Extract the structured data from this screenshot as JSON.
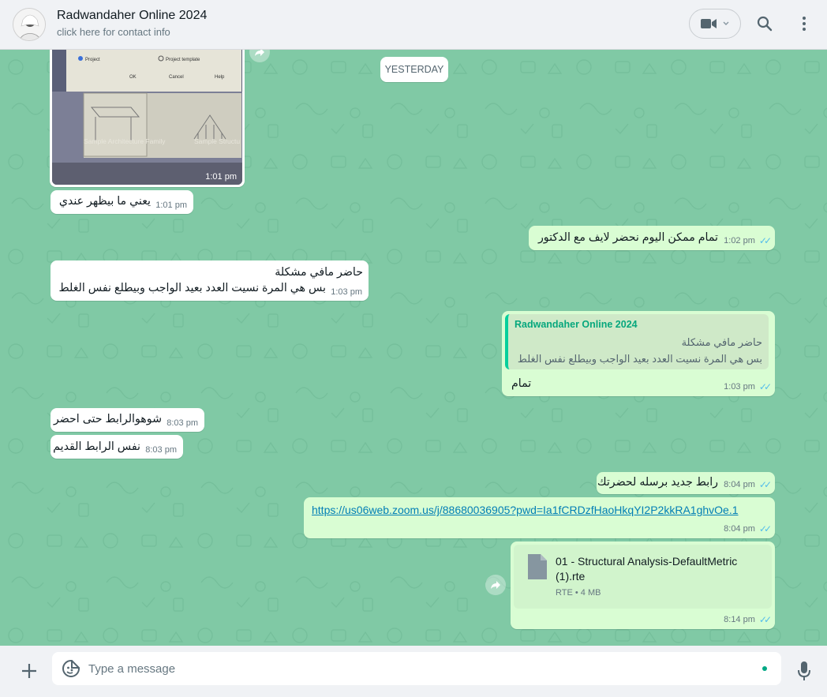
{
  "header": {
    "contact_name": "Radwandaher Online 2024",
    "subtitle": "click here for contact info"
  },
  "chat": {
    "day_divider": "YESTERDAY",
    "image_message": {
      "time": "1:01 pm",
      "image_labels": [
        "Project",
        "Project template",
        "OK",
        "Cancel",
        "Help",
        "Sample Architecture Family",
        "Sample Structu Family"
      ]
    },
    "messages": [
      {
        "dir": "in",
        "text": "يعني ما بيظهر عندي",
        "time": "1:01 pm"
      },
      {
        "dir": "out",
        "text": "تمام ممكن اليوم نحضر لايف  مع الدكتور",
        "time": "1:02 pm"
      },
      {
        "dir": "in",
        "line1": "حاضر مافي مشكلة",
        "line2": "بس هي المرة نسيت العدد بعيد الواجب وبيطلع نفس الغلط",
        "time": "1:03 pm"
      },
      {
        "dir": "out",
        "quote_author": "Radwandaher Online 2024",
        "quote_line1": "حاضر مافي مشكلة",
        "quote_line2": "بس هي المرة نسيت العدد بعيد الواجب وبيطلع نفس الغلط",
        "text": "تمام",
        "time": "1:03 pm"
      },
      {
        "dir": "in",
        "text": "شوهوالرابط حتى احضر",
        "time": "8:03 pm"
      },
      {
        "dir": "in",
        "text": "نفس الرابط القديم",
        "time": "8:03 pm"
      },
      {
        "dir": "out",
        "text": "رابط جديد برسله لحضرتك",
        "time": "8:04 pm"
      },
      {
        "dir": "out",
        "link": "https://us06web.zoom.us/j/88680036905?pwd=Ia1fCRDzfHaoHkqYI2P2kkRA1ghvOe.1",
        "time": "8:04 pm"
      },
      {
        "dir": "out",
        "file_name_line1": "01 - Structural Analysis-DefaultMetric",
        "file_name_line2": "(1).rte",
        "file_meta": "RTE • 4 MB",
        "time": "8:14 pm"
      }
    ]
  },
  "input": {
    "placeholder": "Type a message"
  },
  "colors": {
    "chat_bg": "#80c9a5",
    "incoming": "#ffffff",
    "outgoing": "#d9fdd3",
    "accent": "#00a884",
    "read_ticks": "#53bdeb"
  },
  "icons": [
    "video-icon",
    "search-icon",
    "menu-icon",
    "forward-icon",
    "file-icon",
    "plus-icon",
    "sticker-icon",
    "mic-icon"
  ]
}
